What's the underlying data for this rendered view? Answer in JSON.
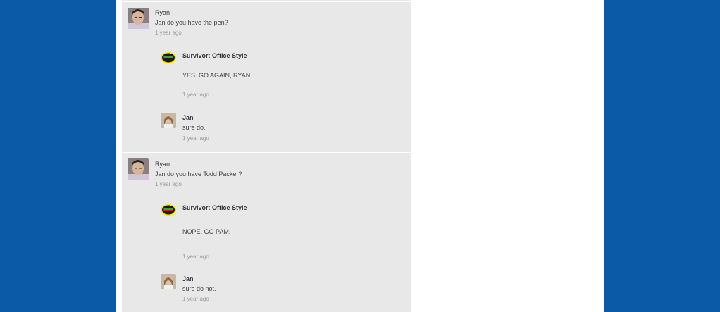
{
  "threads": [
    {
      "post": {
        "author": "Ryan",
        "text": "Jan do you have the pen?",
        "time": "1 year ago"
      },
      "replies": [
        {
          "author": "Survivor: Office Style",
          "text": "YES. GO AGAIN, RYAN.",
          "time": "1 year ago"
        },
        {
          "author": "Jan",
          "text": "sure do.",
          "time": "1 year ago"
        }
      ]
    },
    {
      "post": {
        "author": "Ryan",
        "text": "Jan do you have Todd Packer?",
        "time": "1 year ago"
      },
      "replies": [
        {
          "author": "Survivor: Office Style",
          "text": "NOPE. GO PAM.",
          "time": "1 year ago"
        },
        {
          "author": "Jan",
          "text": "sure do not.",
          "time": "1 year ago"
        }
      ]
    }
  ],
  "colors": {
    "background": "#0b5aa8",
    "feed": "#e8e8e8"
  },
  "icons": {
    "ryan": "ryan-avatar-icon",
    "survivor": "survivor-logo-icon",
    "jan": "jan-avatar-icon"
  }
}
